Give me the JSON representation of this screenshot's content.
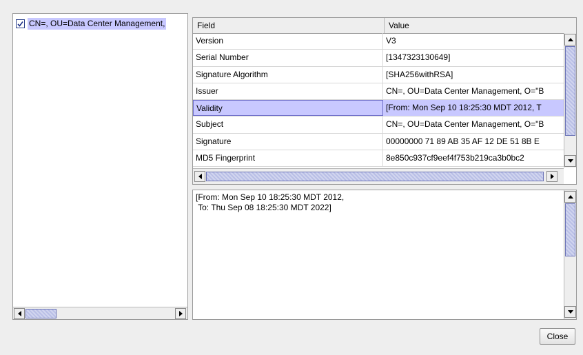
{
  "tree": {
    "node_label": "CN=, OU=Data Center Management,",
    "node_icon": "certificate-icon"
  },
  "table": {
    "columns": [
      "Field",
      "Value"
    ],
    "rows": [
      {
        "field": "Version",
        "value": "V3"
      },
      {
        "field": "Serial Number",
        "value": "[1347323130649]"
      },
      {
        "field": "Signature Algorithm",
        "value": "[SHA256withRSA]"
      },
      {
        "field": "Issuer",
        "value": "CN=, OU=Data Center Management, O=\"B"
      },
      {
        "field": "Validity",
        "value": "[From: Mon Sep 10 18:25:30 MDT 2012, T"
      },
      {
        "field": "Subject",
        "value": "CN=, OU=Data Center Management, O=\"B"
      },
      {
        "field": "Signature",
        "value": "00000000 71 89 AB 35 AF 12 DE 51 8B E"
      },
      {
        "field": "MD5 Fingerprint",
        "value": "8e850c937cf9eef4f753b219ca3b0bc2"
      }
    ],
    "selected_row": 4
  },
  "detail": {
    "text": "[From: Mon Sep 10 18:25:30 MDT 2012,\n To: Thu Sep 08 18:25:30 MDT 2022]"
  },
  "buttons": {
    "close_label": "Close"
  },
  "colors": {
    "selection": "#c8c8ff",
    "scroll_thumb": "#b9bfe6",
    "background": "#eeeeee"
  }
}
